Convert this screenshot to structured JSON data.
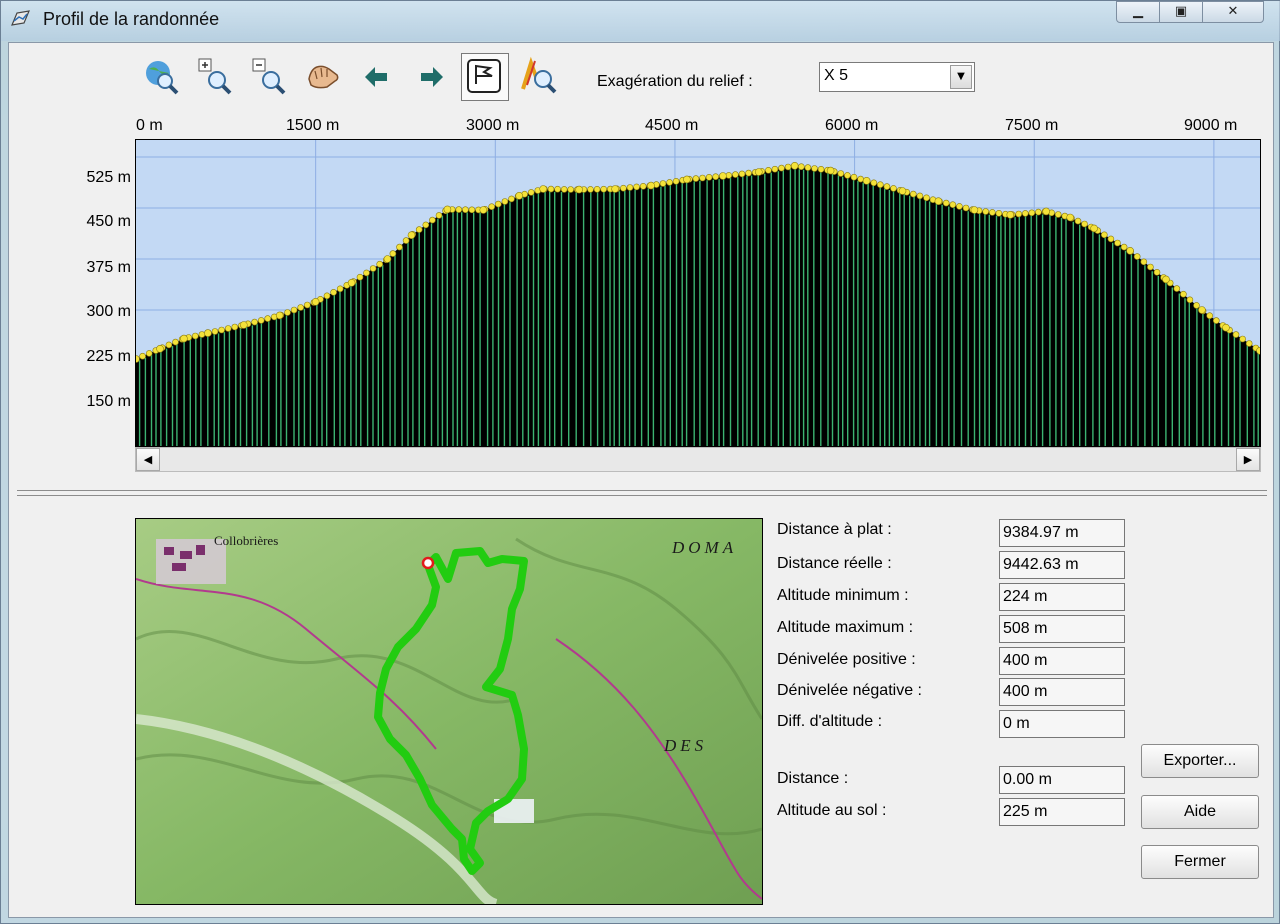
{
  "window": {
    "title": "Profil de la randonnée"
  },
  "toolbar": {
    "tools": [
      "zoom-globe-icon",
      "zoom-in-icon",
      "zoom-out-icon",
      "pan-hand-icon",
      "arrow-left-icon",
      "arrow-right-icon",
      "profile-flag-icon",
      "map-zoom-icon"
    ],
    "relief_label": "Exagération du relief :",
    "relief_value": "X 5"
  },
  "chart_data": {
    "type": "area",
    "x_ticks": [
      "0 m",
      "1500 m",
      "3000 m",
      "4500 m",
      "6000 m",
      "7500 m",
      "9000 m"
    ],
    "y_ticks": [
      "525 m",
      "450 m",
      "375 m",
      "300 m",
      "225 m",
      "150 m"
    ],
    "xlim": [
      0,
      9385
    ],
    "ylim": [
      100,
      550
    ],
    "x": [
      0,
      200,
      400,
      600,
      900,
      1200,
      1500,
      1800,
      2100,
      2300,
      2600,
      2900,
      3200,
      3400,
      3700,
      4000,
      4300,
      4600,
      4900,
      5200,
      5500,
      5800,
      6100,
      6400,
      6700,
      7000,
      7300,
      7600,
      7800,
      8000,
      8300,
      8600,
      8900,
      9100,
      9385
    ],
    "y": [
      228,
      243,
      258,
      266,
      278,
      292,
      312,
      340,
      375,
      410,
      448,
      447,
      468,
      478,
      477,
      478,
      483,
      492,
      497,
      503,
      512,
      505,
      490,
      475,
      460,
      447,
      440,
      445,
      436,
      420,
      387,
      345,
      300,
      274,
      240
    ],
    "colors": {
      "background": "#c3d9f4",
      "fill": "#000000",
      "lines": "#3cb371",
      "points": "#f4e23a",
      "grid": "#8eaee3"
    },
    "grid": true
  },
  "stats": [
    {
      "label": "Distance à plat :",
      "value": "9384.97 m"
    },
    {
      "label": "Distance réelle :",
      "value": "9442.63 m"
    },
    {
      "label": "Altitude minimum :",
      "value": "224 m"
    },
    {
      "label": "Altitude maximum :",
      "value": "508 m"
    },
    {
      "label": "Dénivelée positive :",
      "value": "400 m"
    },
    {
      "label": "Dénivelée négative :",
      "value": "400 m"
    },
    {
      "label": "Diff. d'altitude :",
      "value": "0 m"
    }
  ],
  "cursor": [
    {
      "label": "Distance :",
      "value": "0.00 m"
    },
    {
      "label": "Altitude au sol :",
      "value": "225 m"
    }
  ],
  "buttons": {
    "export": "Exporter...",
    "help": "Aide",
    "close": "Fermer"
  },
  "map": {
    "labels": [
      "Collobrières",
      "DOMA",
      "DES"
    ],
    "colors": {
      "terrain": "#8fbf6a",
      "track": "#22cc11"
    }
  }
}
